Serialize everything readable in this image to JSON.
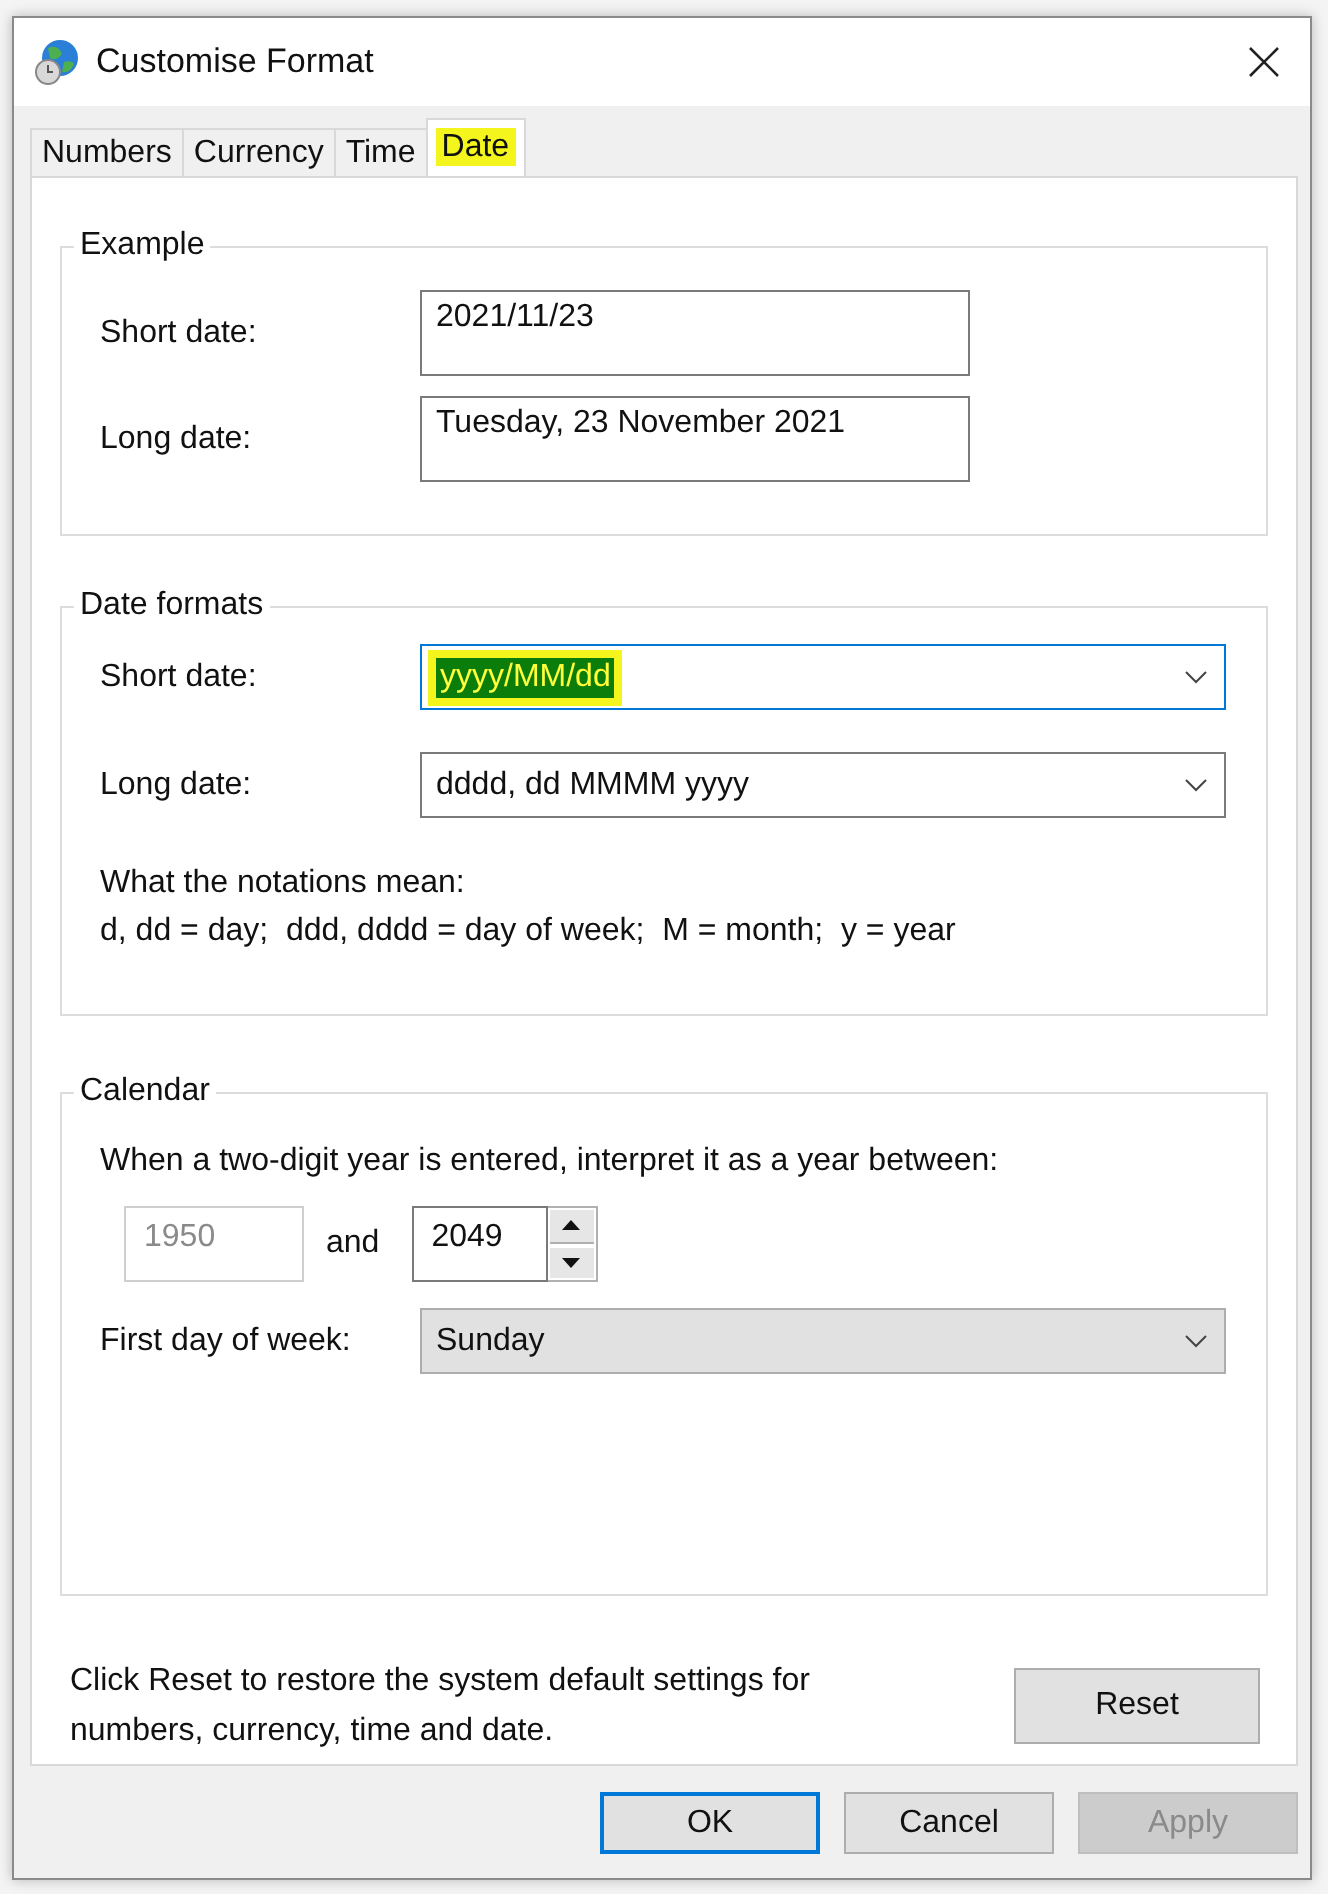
{
  "window": {
    "title": "Customise Format"
  },
  "tabs": [
    {
      "label": "Numbers",
      "selected": false,
      "highlighted": false
    },
    {
      "label": "Currency",
      "selected": false,
      "highlighted": false
    },
    {
      "label": "Time",
      "selected": false,
      "highlighted": false
    },
    {
      "label": "Date",
      "selected": true,
      "highlighted": true
    }
  ],
  "example": {
    "title": "Example",
    "fields": [
      {
        "label": "Short date:",
        "value": "2021/11/23"
      },
      {
        "label": "Long date:",
        "value": "Tuesday, 23 November 2021"
      }
    ]
  },
  "date_formats": {
    "title": "Date formats",
    "fields": [
      {
        "label": "Short date:",
        "value": "yyyy/MM/dd",
        "focused": true,
        "highlighted": true
      },
      {
        "label": "Long date:",
        "value": "dddd, dd MMMM yyyy",
        "focused": false,
        "highlighted": false
      }
    ],
    "notes": [
      "What the notations mean:",
      "d, dd = day;  ddd, dddd = day of week;  M = month;  y = year"
    ]
  },
  "calendar": {
    "title": "Calendar",
    "prompt": "When a two-digit year is entered, interpret it as a year between:",
    "year_from": {
      "value": "1950",
      "disabled": true
    },
    "and_label": "and",
    "year_to": {
      "value": "2049",
      "disabled": false
    },
    "first_day": {
      "label": "First day of week:",
      "value": "Sunday"
    }
  },
  "reset_note": "Click Reset to restore the system default settings for numbers, currency, time and date.",
  "reset_button": {
    "label": "Reset"
  },
  "buttons": [
    {
      "label": "OK",
      "default": true,
      "disabled": false
    },
    {
      "label": "Cancel",
      "default": false,
      "disabled": false
    },
    {
      "label": "Apply",
      "default": false,
      "disabled": true
    }
  ]
}
